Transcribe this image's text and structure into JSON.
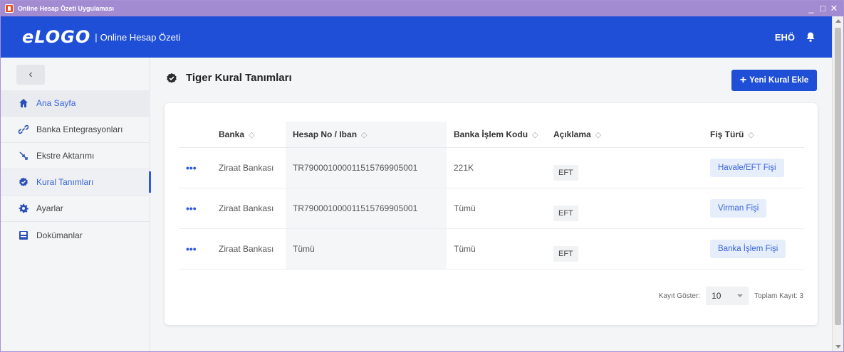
{
  "window": {
    "title": "Online Hesap Özeti Uygulaması",
    "controls": {
      "minimize": "_",
      "maximize": "□",
      "close": "✕"
    }
  },
  "header": {
    "logo": "eLOGO",
    "separator": "|",
    "subtitle": "Online Hesap Özeti",
    "user": "EHÖ",
    "brand_color": "#1f4fd6"
  },
  "sidebar": {
    "collapse_glyph": "‹",
    "items": [
      {
        "label": "Ana Sayfa",
        "icon": "home-icon"
      },
      {
        "label": "Banka Entegrasyonları",
        "icon": "link-icon"
      },
      {
        "label": "Ekstre Aktarımı",
        "icon": "transfer-icon"
      },
      {
        "label": "Kural Tanımları",
        "icon": "badge-check-icon"
      },
      {
        "label": "Ayarlar",
        "icon": "gear-icon"
      },
      {
        "label": "Dokümanlar",
        "icon": "document-icon"
      }
    ]
  },
  "main": {
    "title": "Tiger Kural Tanımları",
    "add_button": "Yeni Kural Ekle",
    "table": {
      "columns": [
        "Banka",
        "Hesap No / Iban",
        "Banka İşlem Kodu",
        "Açıklama",
        "Fiş Türü"
      ],
      "sort_glyph": "◇",
      "rows": [
        {
          "actions": "•••",
          "banka": "Ziraat Bankası",
          "iban": "TR790001000011515769905001",
          "kod": "221K",
          "aciklama": "EFT",
          "fis": "Havale/EFT Fişi"
        },
        {
          "actions": "•••",
          "banka": "Ziraat Bankası",
          "iban": "TR790001000011515769905001",
          "kod": "Tümü",
          "aciklama": "EFT",
          "fis": "Virman Fişi"
        },
        {
          "actions": "•••",
          "banka": "Ziraat Bankası",
          "iban": "Tümü",
          "kod": "Tümü",
          "aciklama": "EFT",
          "fis": "Banka İşlem Fişi"
        }
      ]
    },
    "pager": {
      "label": "Kayıt Göster:",
      "value": "10",
      "total": "Toplam Kayıt: 3"
    }
  }
}
